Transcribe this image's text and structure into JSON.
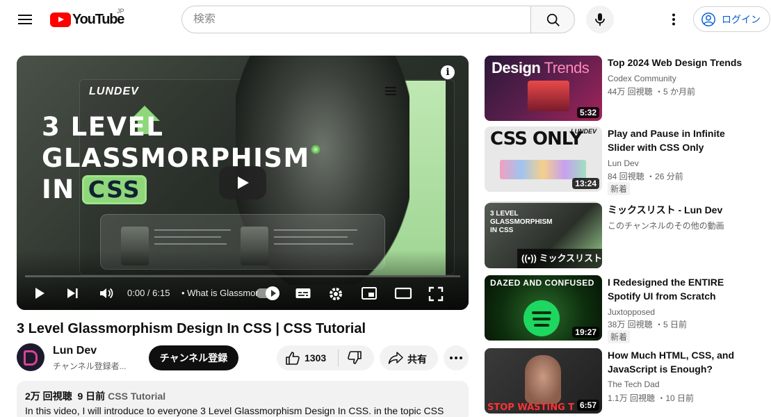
{
  "header": {
    "logo_text": "YouTube",
    "country_code": "JP",
    "search_placeholder": "検索",
    "signin_label": "ログイン"
  },
  "player": {
    "thumbnail_brand": "LUNDEV",
    "thumbnail_title_line1": "3 LEVEL",
    "thumbnail_title_line2": "GLASSMORPHISM",
    "thumbnail_title_line3": "IN",
    "thumbnail_css_badge": "CSS",
    "info_label": "i",
    "current_time": "0:00",
    "time_separator": " / ",
    "duration": "6:15",
    "chapter_title": "• What is Glassmor",
    "progress": 0.0
  },
  "video": {
    "title": "3 Level Glassmorphism Design In CSS | CSS Tutorial",
    "channel_name": "Lun Dev",
    "channel_subs": "チャンネル登録者...",
    "subscribe_label": "チャンネル登録",
    "like_count": "1303",
    "share_label": "共有"
  },
  "description": {
    "views": "2万 回視聴",
    "date": "9 日前",
    "tag": "CSS Tutorial",
    "text": "In this video, I will introduce to everyone 3 Level Glassmorphism Design In CSS. in the topic CSS"
  },
  "recommendations": [
    {
      "title": "Top 2024 Web Design Trends",
      "channel": "Codex Community",
      "stats": "44万 回視聴 ・5 か月前",
      "duration": "5:32",
      "thumb_text_a": "Design",
      "thumb_text_b": " Trends"
    },
    {
      "title": "Play and Pause in Infinite Slider with CSS Only",
      "channel": "Lun Dev",
      "stats": "84 回視聴 ・26 分前",
      "badge": "新着",
      "duration": "13:24",
      "thumb_text": "CSS ONLY",
      "thumb_brand": "LUNDEV"
    },
    {
      "title": "ミックスリスト - Lun Dev",
      "channel": "このチャンネルのその他の動画",
      "overlay": "ミックスリスト",
      "thumb_text": "3 LEVEL GLASSMORPHISM IN CSS"
    },
    {
      "title": "I Redesigned the ENTIRE Spotify UI from Scratch",
      "channel": "Juxtopposed",
      "stats": "38万 回視聴 ・5 日前",
      "badge": "新着",
      "duration": "19:27",
      "thumb_text": "DAZED AND CONFUSED"
    },
    {
      "title": "How Much HTML, CSS, and JavaScript is Enough?",
      "channel": "The Tech Dad",
      "stats": "1.1万 回視聴 ・10 日前",
      "duration": "6:57",
      "thumb_text": "STOP WASTING T"
    }
  ],
  "colors": {
    "brand_red": "#ff0000",
    "link_blue": "#065fd4",
    "accent_green": "#8ed77a"
  },
  "icons": [
    "menu-icon",
    "youtube-logo-icon",
    "search-icon",
    "mic-icon",
    "more-vert-icon",
    "account-icon",
    "info-icon",
    "play-icon",
    "next-icon",
    "volume-icon",
    "autoplay-icon",
    "subtitles-icon",
    "settings-icon",
    "miniplayer-icon",
    "theater-icon",
    "fullscreen-icon",
    "like-icon",
    "dislike-icon",
    "share-icon",
    "more-horiz-icon",
    "playlist-icon"
  ]
}
